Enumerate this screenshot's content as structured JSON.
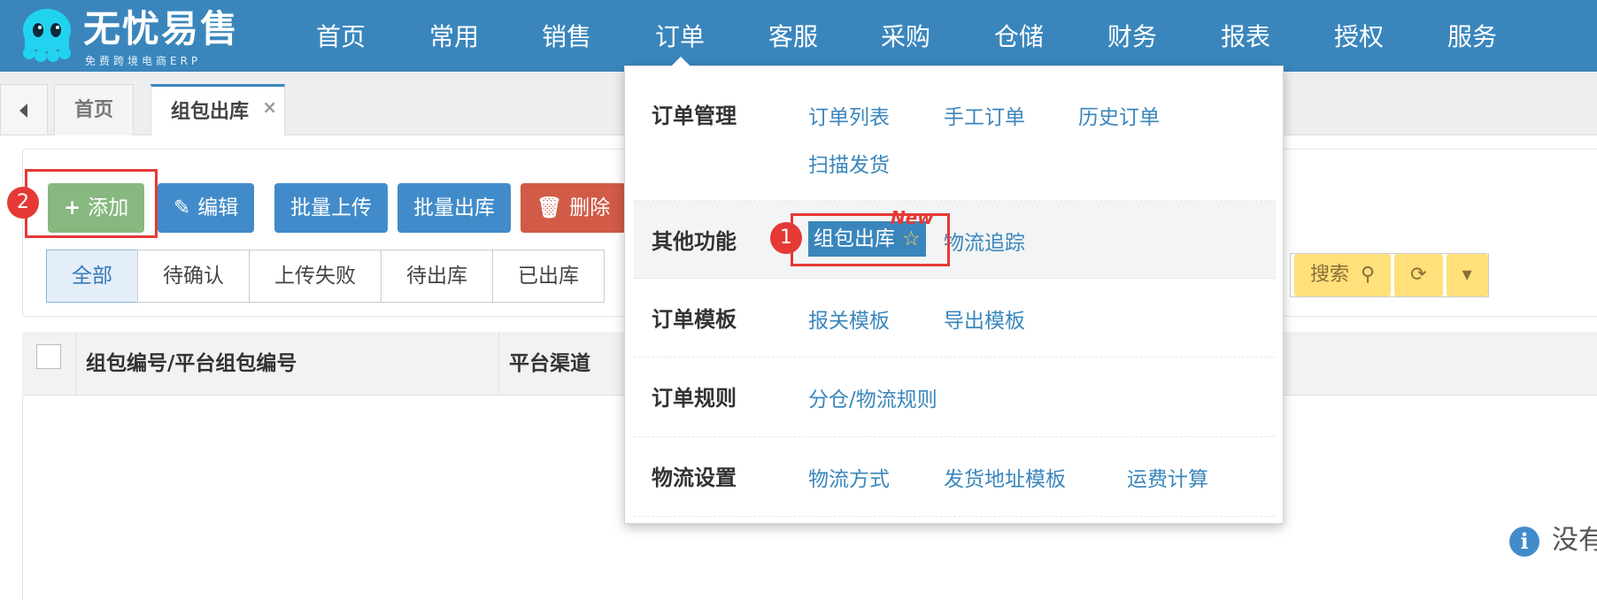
{
  "app": {
    "name": "无忧易售",
    "subtitle": "免费跨境电商ERP"
  },
  "colors": {
    "nav_bg": "#3a86bc",
    "btn_green": "#87b87f",
    "btn_blue": "#428bca",
    "btn_red": "#d15b47",
    "btn_yellow": "#ffe07a",
    "annotation_red": "#e53935"
  },
  "nav": {
    "items": [
      "首页",
      "常用",
      "销售",
      "订单",
      "客服",
      "采购",
      "仓储",
      "财务",
      "报表",
      "授权",
      "服务"
    ]
  },
  "tabs": {
    "items": [
      {
        "label": "首页"
      },
      {
        "label": "组包出库",
        "close": "×"
      }
    ]
  },
  "toolbar": {
    "add_label": "添加",
    "edit_label": "编辑",
    "bulk_upload_label": "批量上传",
    "bulk_ship_label": "批量出库",
    "delete_label": "删除"
  },
  "filters": {
    "items": [
      "全部",
      "待确认",
      "上传失败",
      "待出库",
      "已出库"
    ]
  },
  "search": {
    "search_label": "搜索"
  },
  "table": {
    "columns": [
      "组包编号/平台组包编号",
      "平台渠道"
    ],
    "empty_text": "没有"
  },
  "annotations": {
    "step1": "1",
    "step2": "2"
  },
  "dropdown": {
    "order_mgmt": {
      "title": "订单管理",
      "links": [
        "订单列表",
        "手工订单",
        "历史订单",
        "扫描发货"
      ]
    },
    "other": {
      "title": "其他功能",
      "active_link": "组包出库",
      "new_tag": "New",
      "links": [
        "物流追踪"
      ]
    },
    "templates": {
      "title": "订单模板",
      "links": [
        "报关模板",
        "导出模板"
      ]
    },
    "rules": {
      "title": "订单规则",
      "links": [
        "分仓/物流规则"
      ]
    },
    "logistics": {
      "title": "物流设置",
      "links": [
        "物流方式",
        "发货地址模板",
        "运费计算"
      ]
    }
  }
}
